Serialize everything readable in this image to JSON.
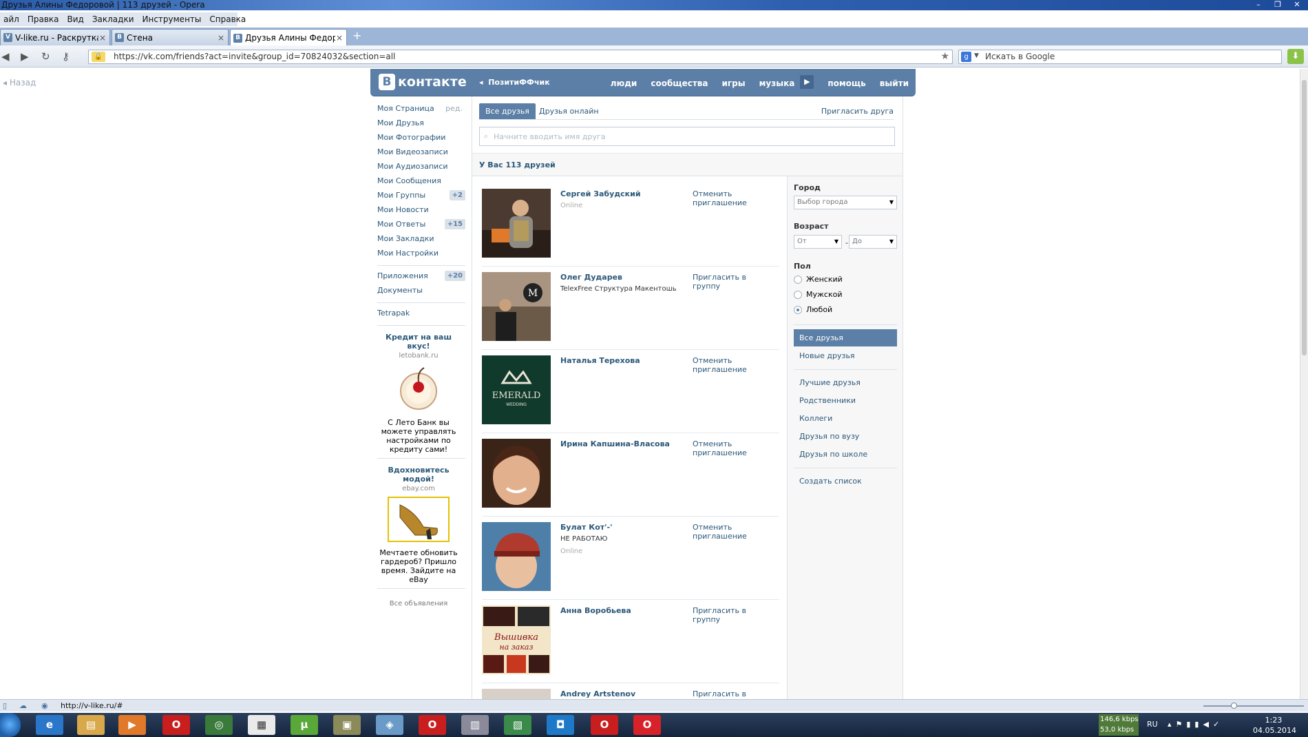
{
  "window": {
    "title": "Друзья Алины Федоровой | 113 друзей - Opera",
    "controls": [
      "–",
      "❐",
      "✕"
    ]
  },
  "menubar": [
    "айл",
    "Правка",
    "Вид",
    "Закладки",
    "Инструменты",
    "Справка"
  ],
  "tabs": [
    {
      "icon": "V",
      "label": "V-like.ru - Раскрутка г..."
    },
    {
      "icon": "В",
      "label": "Стена"
    },
    {
      "icon": "В",
      "label": "Друзья Алины Федор..."
    }
  ],
  "address": {
    "url": "https://vk.com/friends?act=invite&group_id=70824032&section=all"
  },
  "search": {
    "engine_icon": "g",
    "placeholder": "Искать в Google"
  },
  "page": {
    "back_label": "Назад",
    "logo_letter": "В",
    "logo_text": "контакте",
    "group_back": "ПозитиФФчик",
    "nav": [
      "люди",
      "сообщества",
      "игры",
      "музыка",
      "помощь",
      "выйти"
    ]
  },
  "left_menu": {
    "edit_label": "ред.",
    "items": [
      {
        "label": "Моя Страница",
        "badge": ""
      },
      {
        "label": "Мои Друзья",
        "badge": ""
      },
      {
        "label": "Мои Фотографии",
        "badge": ""
      },
      {
        "label": "Мои Видеозаписи",
        "badge": ""
      },
      {
        "label": "Мои Аудиозаписи",
        "badge": ""
      },
      {
        "label": "Мои Сообщения",
        "badge": ""
      },
      {
        "label": "Мои Группы",
        "badge": "+2"
      },
      {
        "label": "Мои Новости",
        "badge": ""
      },
      {
        "label": "Мои Ответы",
        "badge": "+15"
      },
      {
        "label": "Мои Закладки",
        "badge": ""
      },
      {
        "label": "Мои Настройки",
        "badge": ""
      }
    ],
    "apps": [
      {
        "label": "Приложения",
        "badge": "+20"
      },
      {
        "label": "Документы",
        "badge": ""
      }
    ],
    "extra": "Tetrapak"
  },
  "ads": [
    {
      "title": "Кредит на ваш вкус!",
      "domain": "letobank.ru",
      "text": "С Лето Банк вы можете управлять настройками по кредиту сами!"
    },
    {
      "title": "Вдохновитесь модой!",
      "domain": "ebay.com",
      "text": "Мечтаете обновить гардероб? Пришло время. Зайдите на eBay"
    }
  ],
  "all_ads": "Все объявления",
  "friends_tabs": {
    "all": "Все друзья",
    "online": "Друзья онлайн",
    "invite": "Пригласить друга"
  },
  "friend_search_placeholder": "Начните вводить имя друга",
  "friends_count": "У Вас 113 друзей",
  "friends": [
    {
      "name": "Сергей Забудский",
      "sub": "",
      "online": "Online",
      "action": "Отменить приглашение"
    },
    {
      "name": "Олег Дударев",
      "sub": "TelexFree Структура Макентошь",
      "online": "",
      "action": "Пригласить в группу"
    },
    {
      "name": "Наталья Терехова",
      "sub": "",
      "online": "",
      "action": "Отменить приглашение",
      "photo_text": "EMERALD",
      "photo_sub": "WEDDING"
    },
    {
      "name": "Ирина Капшина-Власова",
      "sub": "",
      "online": "",
      "action": "Отменить приглашение"
    },
    {
      "name": "Булат Кот'-'",
      "sub": "НЕ РАБОТАЮ",
      "online": "Online",
      "action": "Отменить приглашение"
    },
    {
      "name": "Анна Воробьева",
      "sub": "",
      "online": "",
      "action": "Пригласить в группу",
      "photo_text": "Вышивка на заказ"
    },
    {
      "name": "Andrey Artstenov",
      "sub": "",
      "online": "",
      "action": "Пригласить в группу"
    }
  ],
  "filters": {
    "city_label": "Город",
    "city_select": "Выбор города",
    "age_label": "Возраст",
    "age_from": "От",
    "age_to": "До",
    "age_dash": "-",
    "gender_label": "Пол",
    "genders": [
      "Женский",
      "Мужской",
      "Любой"
    ],
    "gender_selected": "Любой",
    "lists_primary": [
      "Все друзья",
      "Новые друзья"
    ],
    "lists_secondary": [
      "Лучшие друзья",
      "Родственники",
      "Коллеги",
      "Друзья по вузу",
      "Друзья по школе"
    ],
    "create_list": "Создать список"
  },
  "statusbar": {
    "url": "http://v-like.ru/#"
  },
  "taskbar": {
    "net_up": "146,6 kbps",
    "net_down": "53,0 kbps",
    "lang": "RU",
    "time": "1:23",
    "date": "04.05.2014"
  },
  "colors": {
    "vk_blue": "#5b7fa6",
    "link": "#2b587a",
    "muted": "#9aa7b6"
  }
}
